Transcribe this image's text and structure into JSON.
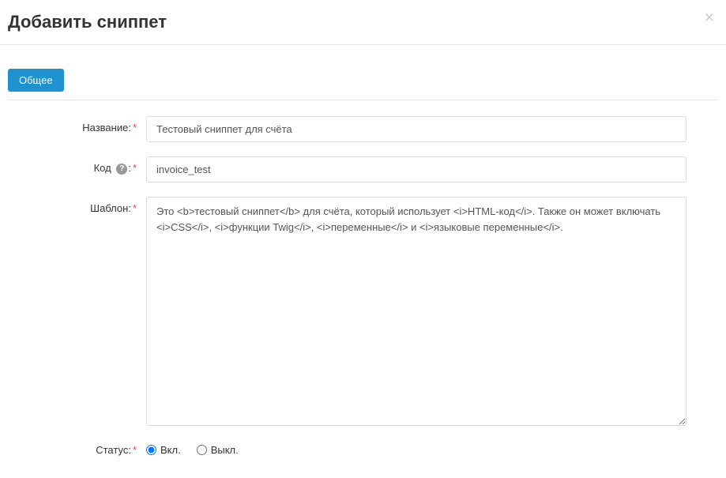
{
  "modal": {
    "title": "Добавить сниппет"
  },
  "tabs": {
    "general": "Общее"
  },
  "form": {
    "name": {
      "label": "Название:",
      "value": "Тестовый сниппет для счёта"
    },
    "code": {
      "label": "Код",
      "value": "invoice_test"
    },
    "template": {
      "label": "Шаблон:",
      "value": "Это <b>тестовый сниппет</b> для счёта, который использует <i>HTML-код</i>. Также он может включать <i>CSS</i>, <i>функции Twig</i>, <i>переменные</i> и <i>языковые переменные</i>."
    },
    "status": {
      "label": "Статус:",
      "on": "Вкл.",
      "off": "Выкл."
    }
  }
}
